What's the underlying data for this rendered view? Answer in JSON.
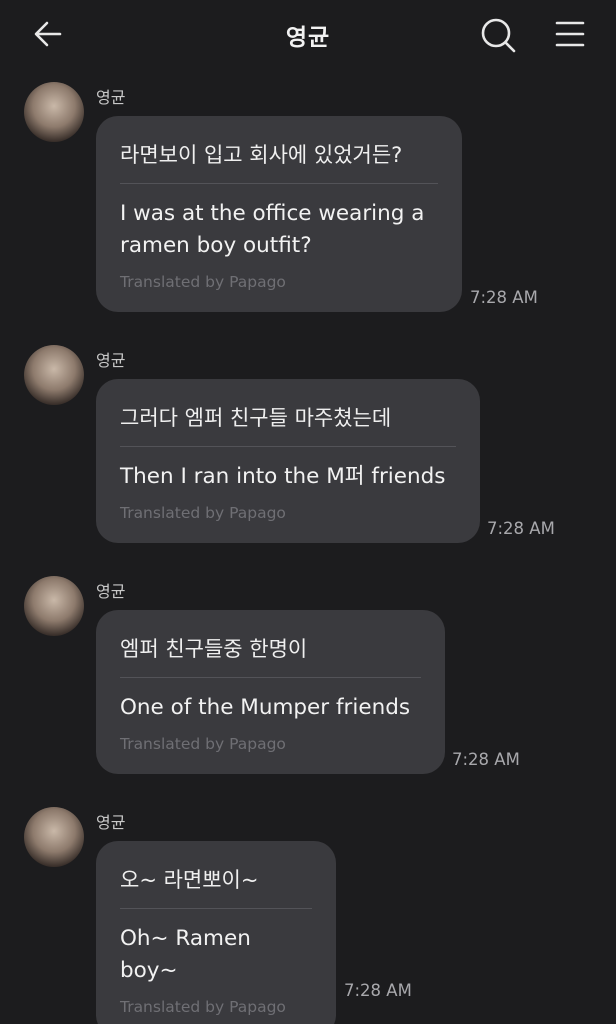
{
  "header": {
    "title": "영균",
    "back_icon": "arrow-left-icon",
    "search_icon": "search-icon",
    "menu_icon": "hamburger-menu-icon"
  },
  "messages": [
    {
      "sender": "영균",
      "original": "라면보이 입고 회사에 있었거든?",
      "translation": "I was at the office wearing a ramen boy outfit?",
      "translated_by": "Translated by Papago",
      "time": "7:28 AM"
    },
    {
      "sender": "영균",
      "original": "그러다 엠퍼 친구들 마주쳤는데",
      "translation": "Then I ran into the M퍼 friends",
      "translated_by": "Translated by Papago",
      "time": "7:28 AM"
    },
    {
      "sender": "영균",
      "original": "엠퍼 친구들중 한명이",
      "translation": "One of the Mumper friends",
      "translated_by": "Translated by Papago",
      "time": "7:28 AM"
    },
    {
      "sender": "영균",
      "original": "오~ 라면뽀이~",
      "translation": "Oh~ Ramen boy~",
      "translated_by": "Translated by Papago",
      "time": "7:28 AM"
    }
  ]
}
